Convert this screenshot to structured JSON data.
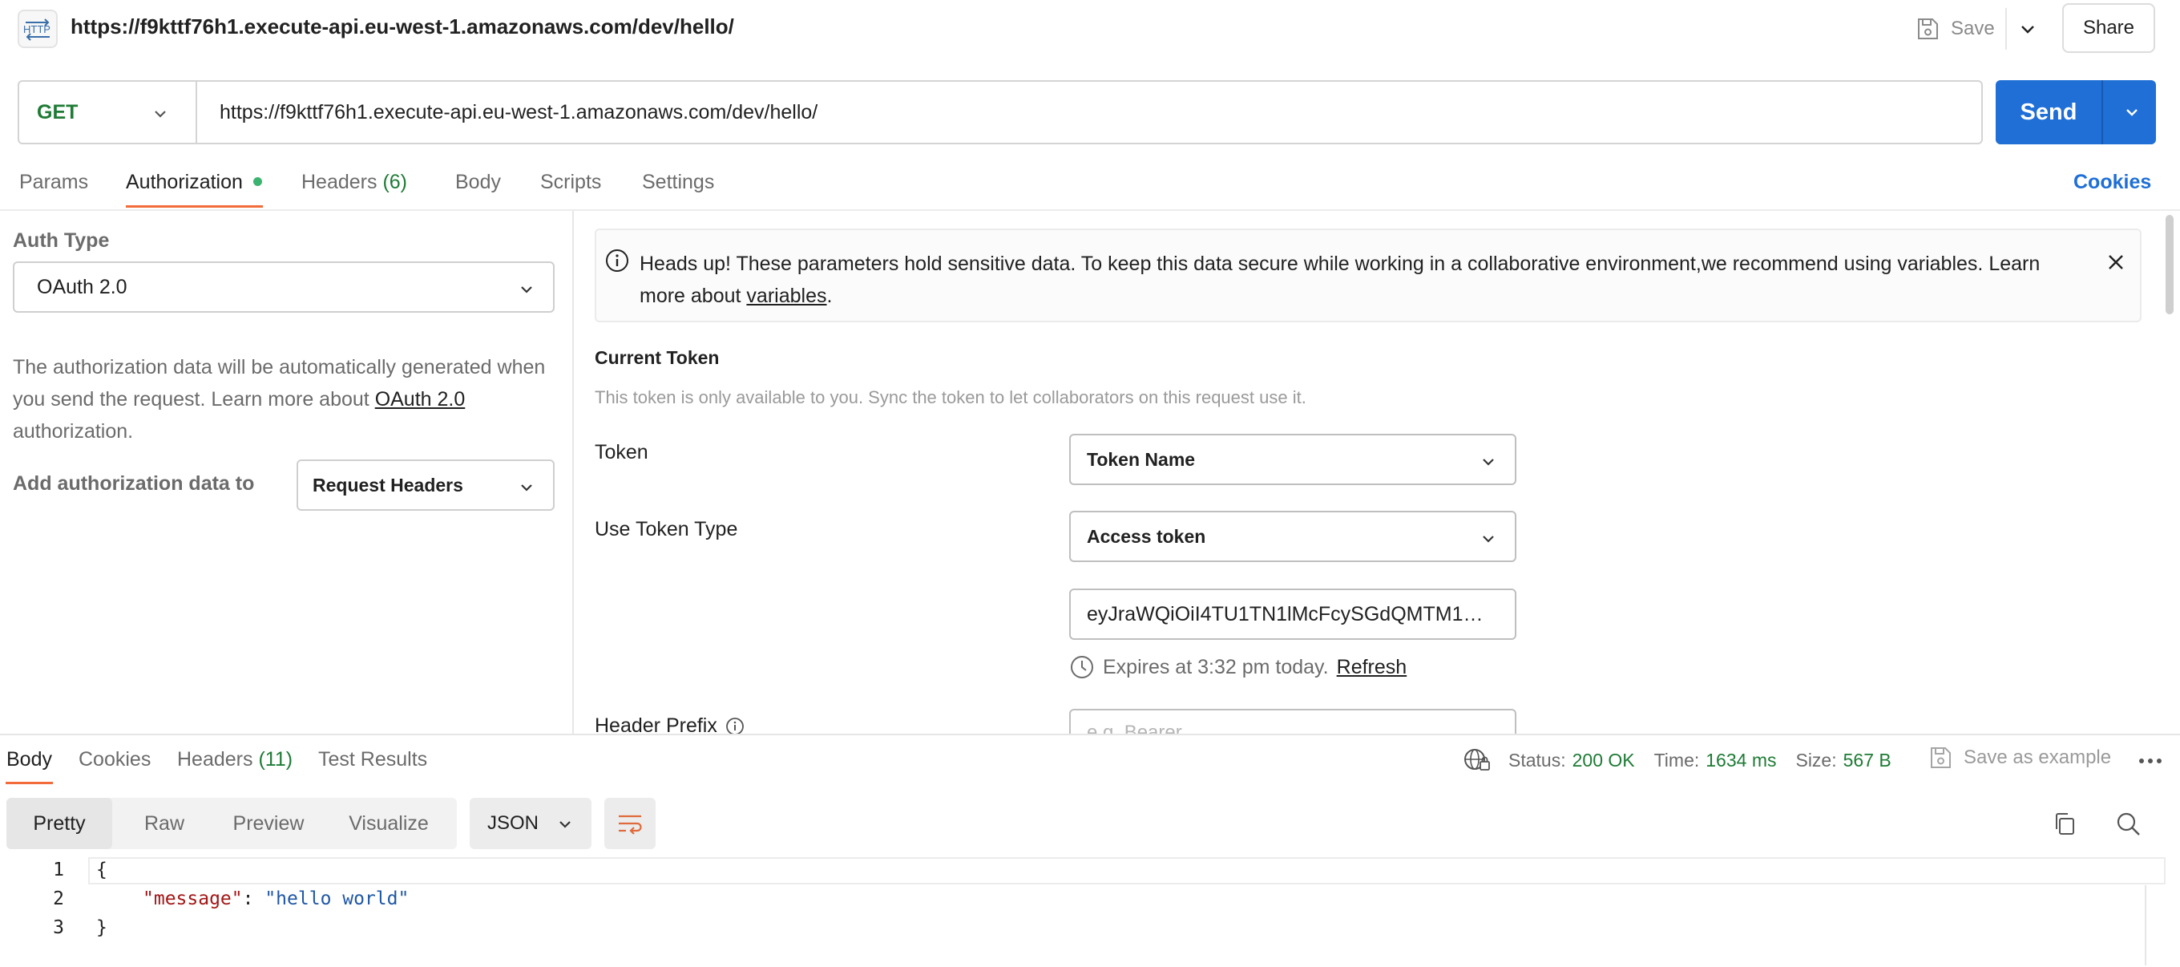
{
  "top_bar": {
    "app_icon_label": "HTTP",
    "request_title": "https://f9kttf76h1.execute-api.eu-west-1.amazonaws.com/dev/hello/",
    "save_label": "Save",
    "share_label": "Share"
  },
  "request": {
    "method": "GET",
    "url": "https://f9kttf76h1.execute-api.eu-west-1.amazonaws.com/dev/hello/",
    "send_label": "Send"
  },
  "request_tabs": {
    "params": "Params",
    "authorization": "Authorization",
    "headers": "Headers",
    "headers_count": "(6)",
    "body": "Body",
    "scripts": "Scripts",
    "settings": "Settings",
    "cookies": "Cookies",
    "active": "Authorization"
  },
  "auth": {
    "auth_type_label": "Auth Type",
    "auth_type_value": "OAuth 2.0",
    "description_pre": "The authorization data will be automatically generated when you send the request. Learn more about ",
    "description_link": "OAuth 2.0",
    "description_post": " authorization.",
    "add_to_label": "Add authorization data to",
    "add_to_value": "Request Headers"
  },
  "alert": {
    "text": "Heads up! These parameters hold sensitive data. To keep this data secure while working in a collaborative environment,we recommend using variables. Learn more about ",
    "link": "variables",
    "suffix": "."
  },
  "current_token": {
    "title": "Current Token",
    "hint": "This token is only available to you. Sync the token to let collaborators on this request use it.",
    "token_label": "Token",
    "token_select": "Token Name",
    "use_token_type_label": "Use Token Type",
    "use_token_type_value": "Access token",
    "token_value": "eyJraWQiOiI4TU1TN1lMcFcySGdQMTM1Mm...",
    "expires_text": "Expires at 3:32 pm today.",
    "refresh_label": "Refresh",
    "header_prefix_label": "Header Prefix",
    "header_prefix_placeholder": "e.g. Bearer"
  },
  "response": {
    "tabs": {
      "body": "Body",
      "cookies": "Cookies",
      "headers": "Headers",
      "headers_count": "(11)",
      "test_results": "Test Results",
      "active": "Body"
    },
    "status_label": "Status:",
    "status_value": "200 OK",
    "time_label": "Time:",
    "time_value": "1634 ms",
    "size_label": "Size:",
    "size_value": "567 B",
    "save_example_label": "Save as example",
    "view_modes": [
      "Pretty",
      "Raw",
      "Preview",
      "Visualize"
    ],
    "active_view": "Pretty",
    "format": "JSON",
    "code": {
      "line_numbers": [
        "1",
        "2",
        "3"
      ],
      "open_brace": "{",
      "key": "\"message\"",
      "colon": ": ",
      "value": "\"hello world\"",
      "close_brace": "}"
    }
  },
  "colors": {
    "accent_blue": "#1f6fd6",
    "method_green": "#1e7b35",
    "tab_underline": "#f26b3a",
    "status_green": "#1e7b35"
  }
}
